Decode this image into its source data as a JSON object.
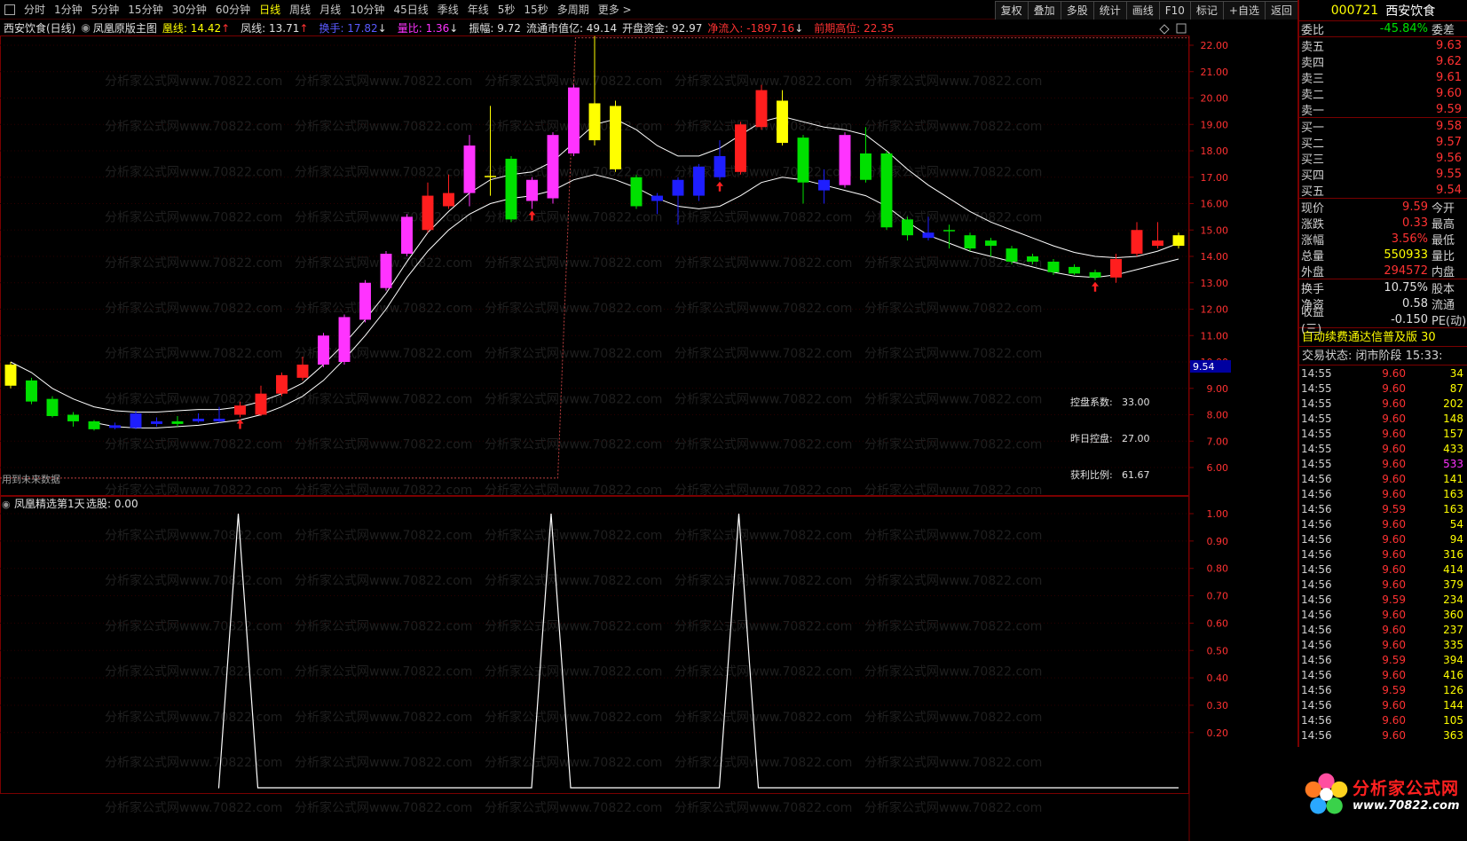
{
  "toolbar": {
    "items": [
      "分时",
      "1分钟",
      "5分钟",
      "15分钟",
      "30分钟",
      "60分钟",
      "日线",
      "周线",
      "月线",
      "10分钟",
      "45日线",
      "季线",
      "年线",
      "5秒",
      "15秒",
      "多周期",
      "更多 >"
    ],
    "active_index": 6,
    "right_buttons": [
      "复权",
      "叠加",
      "多股",
      "统计",
      "画线",
      "F10",
      "标记",
      "+自选",
      "返回"
    ]
  },
  "info": {
    "stock_period": "西安饮食(日线)",
    "indicator_name": "凤凰原版主图",
    "huang_label": "凰线: 14.42",
    "feng_label": "凤线: 13.71",
    "huanshou_label": "换手: 17.82",
    "liangbi_label": "量比: 1.36",
    "zhenfu_label": "振幅: 9.72",
    "ltsz_label": "流通市值亿: 49.14",
    "kpzj_label": "开盘资金: 92.97",
    "jlr_label": "净流入: -1897.16",
    "qqgw_label": "前期高位: 22.35",
    "future_data_note": "用到未来数据",
    "kongpan_label": "控盘系数:",
    "kongpan_val": "33.00",
    "zrkp_label": "昨日控盘:",
    "zrkp_val": "27.00",
    "hlbl_label": "获利比例:",
    "hlbl_val": "61.67",
    "current_price_tag": "9.54",
    "sub_indicator": "凤凰精选第1天",
    "sub_select": "选股: 0.00",
    "watermark": "分析家公式网www.70822.com"
  },
  "chart_data": [
    {
      "type": "candlestick",
      "title": "西安饮食(日线)",
      "ylim": [
        5.5,
        22.5
      ],
      "y_ticks": [
        "22.00",
        "21.00",
        "20.00",
        "19.00",
        "18.00",
        "17.00",
        "16.00",
        "15.00",
        "14.00",
        "13.00",
        "12.00",
        "11.00",
        "10.00",
        "9.00",
        "8.00",
        "7.00",
        "6.00"
      ],
      "candles": [
        {
          "o": 9.9,
          "c": 9.1,
          "h": 10.0,
          "l": 9.0,
          "col": "yellow"
        },
        {
          "o": 9.3,
          "c": 8.5,
          "h": 9.4,
          "l": 8.4,
          "col": "green"
        },
        {
          "o": 8.6,
          "c": 7.95,
          "h": 8.7,
          "l": 7.9,
          "col": "green"
        },
        {
          "o": 8.0,
          "c": 7.75,
          "h": 8.1,
          "l": 7.55,
          "col": "green"
        },
        {
          "o": 7.75,
          "c": 7.45,
          "h": 7.8,
          "l": 7.4,
          "col": "green"
        },
        {
          "o": 7.6,
          "c": 7.5,
          "h": 7.7,
          "l": 7.45,
          "col": "blue"
        },
        {
          "o": 8.05,
          "c": 7.5,
          "h": 8.15,
          "l": 7.45,
          "col": "blue"
        },
        {
          "o": 7.75,
          "c": 7.65,
          "h": 7.9,
          "l": 7.55,
          "col": "blue"
        },
        {
          "o": 7.75,
          "c": 7.65,
          "h": 7.95,
          "l": 7.55,
          "col": "green"
        },
        {
          "o": 7.85,
          "c": 7.75,
          "h": 8.05,
          "l": 7.7,
          "col": "blue"
        },
        {
          "o": 7.85,
          "c": 7.75,
          "h": 8.3,
          "l": 7.7,
          "col": "blue"
        },
        {
          "o": 8.0,
          "c": 8.35,
          "h": 8.5,
          "l": 7.9,
          "col": "red"
        },
        {
          "o": 8.0,
          "c": 8.8,
          "h": 9.1,
          "l": 7.95,
          "col": "red"
        },
        {
          "o": 8.8,
          "c": 9.5,
          "h": 9.6,
          "l": 8.7,
          "col": "red"
        },
        {
          "o": 9.4,
          "c": 9.9,
          "h": 10.2,
          "l": 9.3,
          "col": "red"
        },
        {
          "o": 9.9,
          "c": 11.0,
          "h": 11.1,
          "l": 9.8,
          "col": "magenta"
        },
        {
          "o": 10.0,
          "c": 11.7,
          "h": 11.8,
          "l": 9.9,
          "col": "magenta"
        },
        {
          "o": 11.6,
          "c": 13.0,
          "h": 13.1,
          "l": 11.5,
          "col": "magenta"
        },
        {
          "o": 12.8,
          "c": 14.1,
          "h": 14.2,
          "l": 12.7,
          "col": "magenta"
        },
        {
          "o": 14.1,
          "c": 15.5,
          "h": 15.6,
          "l": 14.0,
          "col": "magenta"
        },
        {
          "o": 15.0,
          "c": 16.3,
          "h": 16.8,
          "l": 14.9,
          "col": "red"
        },
        {
          "o": 15.9,
          "c": 16.4,
          "h": 17.1,
          "l": 15.8,
          "col": "red"
        },
        {
          "o": 16.4,
          "c": 18.2,
          "h": 18.6,
          "l": 15.9,
          "col": "magenta"
        },
        {
          "o": 17.05,
          "c": 17.0,
          "h": 19.7,
          "l": 16.3,
          "col": "yellow"
        },
        {
          "o": 17.7,
          "c": 15.4,
          "h": 17.8,
          "l": 15.3,
          "col": "green"
        },
        {
          "o": 16.1,
          "c": 16.9,
          "h": 17.0,
          "l": 15.8,
          "col": "magenta"
        },
        {
          "o": 16.2,
          "c": 18.6,
          "h": 18.7,
          "l": 16.0,
          "col": "magenta"
        },
        {
          "o": 17.9,
          "c": 20.4,
          "h": 20.5,
          "l": 17.8,
          "col": "magenta"
        },
        {
          "o": 19.8,
          "c": 18.4,
          "h": 22.35,
          "l": 18.2,
          "col": "yellow"
        },
        {
          "o": 19.7,
          "c": 17.3,
          "h": 19.9,
          "l": 17.2,
          "col": "yellow"
        },
        {
          "o": 17.0,
          "c": 15.9,
          "h": 17.1,
          "l": 15.8,
          "col": "green"
        },
        {
          "o": 16.3,
          "c": 16.1,
          "h": 16.4,
          "l": 15.6,
          "col": "blue"
        },
        {
          "o": 16.9,
          "c": 16.3,
          "h": 17.0,
          "l": 15.2,
          "col": "blue"
        },
        {
          "o": 17.4,
          "c": 16.3,
          "h": 17.5,
          "l": 16.1,
          "col": "blue"
        },
        {
          "o": 17.8,
          "c": 17.0,
          "h": 18.4,
          "l": 16.9,
          "col": "blue"
        },
        {
          "o": 17.2,
          "c": 19.0,
          "h": 19.1,
          "l": 17.1,
          "col": "red"
        },
        {
          "o": 18.9,
          "c": 20.3,
          "h": 20.5,
          "l": 18.8,
          "col": "red"
        },
        {
          "o": 19.9,
          "c": 18.3,
          "h": 20.3,
          "l": 18.2,
          "col": "yellow"
        },
        {
          "o": 18.5,
          "c": 16.8,
          "h": 18.6,
          "l": 16.0,
          "col": "green"
        },
        {
          "o": 16.9,
          "c": 16.5,
          "h": 17.3,
          "l": 16.0,
          "col": "blue"
        },
        {
          "o": 16.7,
          "c": 18.6,
          "h": 18.7,
          "l": 16.6,
          "col": "magenta"
        },
        {
          "o": 17.9,
          "c": 16.9,
          "h": 18.9,
          "l": 16.8,
          "col": "green"
        },
        {
          "o": 17.9,
          "c": 15.1,
          "h": 18.0,
          "l": 15.0,
          "col": "green"
        },
        {
          "o": 15.4,
          "c": 14.8,
          "h": 15.5,
          "l": 14.6,
          "col": "green"
        },
        {
          "o": 14.9,
          "c": 14.7,
          "h": 15.5,
          "l": 14.6,
          "col": "blue"
        },
        {
          "o": 15.0,
          "c": 14.95,
          "h": 15.2,
          "l": 14.3,
          "col": "green"
        },
        {
          "o": 14.8,
          "c": 14.3,
          "h": 14.9,
          "l": 14.2,
          "col": "green"
        },
        {
          "o": 14.6,
          "c": 14.4,
          "h": 14.7,
          "l": 14.0,
          "col": "green"
        },
        {
          "o": 14.3,
          "c": 13.8,
          "h": 14.4,
          "l": 13.7,
          "col": "green"
        },
        {
          "o": 14.0,
          "c": 13.8,
          "h": 14.1,
          "l": 13.7,
          "col": "green"
        },
        {
          "o": 13.8,
          "c": 13.4,
          "h": 13.9,
          "l": 13.3,
          "col": "green"
        },
        {
          "o": 13.6,
          "c": 13.35,
          "h": 13.7,
          "l": 13.3,
          "col": "green"
        },
        {
          "o": 13.4,
          "c": 13.2,
          "h": 13.5,
          "l": 13.1,
          "col": "green"
        },
        {
          "o": 13.2,
          "c": 13.9,
          "h": 14.1,
          "l": 13.0,
          "col": "red"
        },
        {
          "o": 14.1,
          "c": 15.0,
          "h": 15.3,
          "l": 14.0,
          "col": "red"
        },
        {
          "o": 14.4,
          "c": 14.6,
          "h": 15.3,
          "l": 14.3,
          "col": "red"
        },
        {
          "o": 14.4,
          "c": 14.8,
          "h": 14.9,
          "l": 14.3,
          "col": "yellow"
        }
      ],
      "huang_line": [
        10.0,
        9.6,
        9.0,
        8.6,
        8.3,
        8.15,
        8.1,
        8.1,
        8.15,
        8.2,
        8.2,
        8.3,
        8.5,
        8.8,
        9.2,
        9.9,
        10.7,
        11.6,
        12.6,
        13.8,
        14.9,
        15.7,
        16.4,
        16.9,
        17.1,
        17.2,
        17.6,
        18.3,
        19.0,
        19.2,
        18.8,
        18.2,
        17.8,
        17.8,
        18.1,
        18.6,
        19.1,
        19.3,
        19.1,
        18.9,
        18.8,
        18.6,
        18.0,
        17.3,
        16.7,
        16.2,
        15.7,
        15.3,
        15.0,
        14.7,
        14.4,
        14.15,
        14.0,
        13.95,
        14.0,
        14.2,
        14.5
      ],
      "feng_line": [
        null,
        null,
        null,
        null,
        7.7,
        7.55,
        7.5,
        7.5,
        7.55,
        7.6,
        7.7,
        7.8,
        8.0,
        8.3,
        8.7,
        9.3,
        10.1,
        11.0,
        12.0,
        13.2,
        14.2,
        15.0,
        15.6,
        16.0,
        16.2,
        16.3,
        16.5,
        16.9,
        17.1,
        16.9,
        16.6,
        16.2,
        15.9,
        15.8,
        15.9,
        16.3,
        16.8,
        17.0,
        16.9,
        16.7,
        16.5,
        16.3,
        15.9,
        15.3,
        14.8,
        14.5,
        14.2,
        14.0,
        13.8,
        13.6,
        13.4,
        13.25,
        13.2,
        13.3,
        13.5,
        13.7,
        13.9
      ],
      "up_arrows": [
        11,
        25,
        34,
        52
      ],
      "pink_dotted_step": {
        "low_to_idx": 27,
        "low": 5.6,
        "high": 22.35
      }
    },
    {
      "type": "line",
      "title": "凤凰精选第1天",
      "ylim": [
        0,
        1.08
      ],
      "y_ticks": [
        "1.00",
        "0.90",
        "0.80",
        "0.70",
        "0.60",
        "0.50",
        "0.40",
        "0.30",
        "0.20"
      ],
      "spikes_at": [
        11,
        26,
        35
      ]
    }
  ],
  "panel": {
    "code": "000721",
    "name": "西安饮食",
    "weibi_label": "委比",
    "weibi_val": "-45.84%",
    "weicha_label": "委差",
    "asks": [
      {
        "label": "卖五",
        "price": "9.63"
      },
      {
        "label": "卖四",
        "price": "9.62"
      },
      {
        "label": "卖三",
        "price": "9.61"
      },
      {
        "label": "卖二",
        "price": "9.60"
      },
      {
        "label": "卖一",
        "price": "9.59"
      }
    ],
    "bids": [
      {
        "label": "买一",
        "price": "9.58"
      },
      {
        "label": "买二",
        "price": "9.57"
      },
      {
        "label": "买三",
        "price": "9.56"
      },
      {
        "label": "买四",
        "price": "9.55"
      },
      {
        "label": "买五",
        "price": "9.54"
      }
    ],
    "stats": [
      {
        "l1": "现价",
        "v": "9.59",
        "l2": "今开",
        "vc": "red"
      },
      {
        "l1": "涨跌",
        "v": "0.33",
        "l2": "最高",
        "vc": "red"
      },
      {
        "l1": "涨幅",
        "v": "3.56%",
        "l2": "最低",
        "vc": "red"
      },
      {
        "l1": "总量",
        "v": "550933",
        "l2": "量比",
        "vc": "yellow"
      },
      {
        "l1": "外盘",
        "v": "294572",
        "l2": "内盘",
        "vc": "red"
      }
    ],
    "stats2": [
      {
        "l1": "换手",
        "v": "10.75%",
        "l2": "股本",
        "vc": "white"
      },
      {
        "l1": "净资",
        "v": "0.58",
        "l2": "流通",
        "vc": "white"
      },
      {
        "l1": "收益(三)",
        "v": "-0.150",
        "l2": "PE(动)",
        "vc": "white"
      }
    ],
    "ticker": "自动续费通达信普及版 30",
    "trade_status": "交易状态: 闭市阶段 15:33:",
    "ticks": [
      {
        "t": "14:55",
        "p": "9.60",
        "v": "34"
      },
      {
        "t": "14:55",
        "p": "9.60",
        "v": "87"
      },
      {
        "t": "14:55",
        "p": "9.60",
        "v": "202"
      },
      {
        "t": "14:55",
        "p": "9.60",
        "v": "148"
      },
      {
        "t": "14:55",
        "p": "9.60",
        "v": "157"
      },
      {
        "t": "14:55",
        "p": "9.60",
        "v": "433"
      },
      {
        "t": "14:55",
        "p": "9.60",
        "v": "533",
        "mag": true
      },
      {
        "t": "14:56",
        "p": "9.60",
        "v": "141"
      },
      {
        "t": "14:56",
        "p": "9.60",
        "v": "163"
      },
      {
        "t": "14:56",
        "p": "9.59",
        "v": "163"
      },
      {
        "t": "14:56",
        "p": "9.60",
        "v": "54"
      },
      {
        "t": "14:56",
        "p": "9.60",
        "v": "94"
      },
      {
        "t": "14:56",
        "p": "9.60",
        "v": "316"
      },
      {
        "t": "14:56",
        "p": "9.60",
        "v": "414"
      },
      {
        "t": "14:56",
        "p": "9.60",
        "v": "379"
      },
      {
        "t": "14:56",
        "p": "9.59",
        "v": "234"
      },
      {
        "t": "14:56",
        "p": "9.60",
        "v": "360"
      },
      {
        "t": "14:56",
        "p": "9.60",
        "v": "237"
      },
      {
        "t": "14:56",
        "p": "9.60",
        "v": "335"
      },
      {
        "t": "14:56",
        "p": "9.59",
        "v": "394"
      },
      {
        "t": "14:56",
        "p": "9.60",
        "v": "416"
      },
      {
        "t": "14:56",
        "p": "9.59",
        "v": "126"
      },
      {
        "t": "14:56",
        "p": "9.60",
        "v": "144"
      },
      {
        "t": "14:56",
        "p": "9.60",
        "v": "105"
      },
      {
        "t": "14:56",
        "p": "9.60",
        "v": "363"
      }
    ],
    "logo_text": "分析家公式网",
    "logo_url": "www.70822.com"
  }
}
